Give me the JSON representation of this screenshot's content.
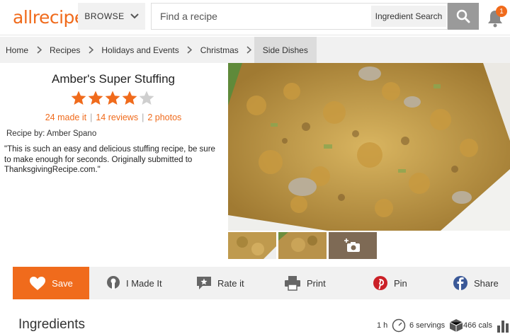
{
  "header": {
    "logo_text": "allrecipes",
    "browse_label": "BROWSE",
    "search_placeholder": "Find a recipe",
    "ingredient_search_label": "Ingredient Search",
    "notification_count": "1",
    "accent_color": "#f06b1c"
  },
  "breadcrumb": [
    {
      "label": "Home"
    },
    {
      "label": "Recipes"
    },
    {
      "label": "Holidays and Events"
    },
    {
      "label": "Christmas"
    },
    {
      "label": "Side Dishes"
    }
  ],
  "recipe": {
    "title": "Amber's Super Stuffing",
    "rating": 4,
    "rating_max": 5,
    "made_it": "24 made it",
    "reviews": "14 reviews",
    "photos": "2 photos",
    "recipe_by_label": "Recipe by:",
    "author": "Amber Spano",
    "description": "\"This is such an easy and delicious stuffing recipe, be sure to make enough for seconds. Originally submitted to ThanksgivingRecipe.com.\""
  },
  "actions": {
    "save": "Save",
    "made_it": "I Made It",
    "rate_it": "Rate it",
    "print": "Print",
    "pin": "Pin",
    "share": "Share"
  },
  "ingredients": {
    "title": "Ingredients",
    "time": "1 h",
    "servings": "6 servings",
    "calories": "466 cals"
  },
  "icons": [
    "chevron-down-icon",
    "search-icon",
    "bell-icon",
    "chevron-right-icon",
    "star-icon",
    "heart-icon",
    "chef-hat-icon",
    "rate-icon",
    "print-icon",
    "pinterest-icon",
    "facebook-icon",
    "camera-icon",
    "clock-icon",
    "servings-icon",
    "nutrition-icon"
  ]
}
